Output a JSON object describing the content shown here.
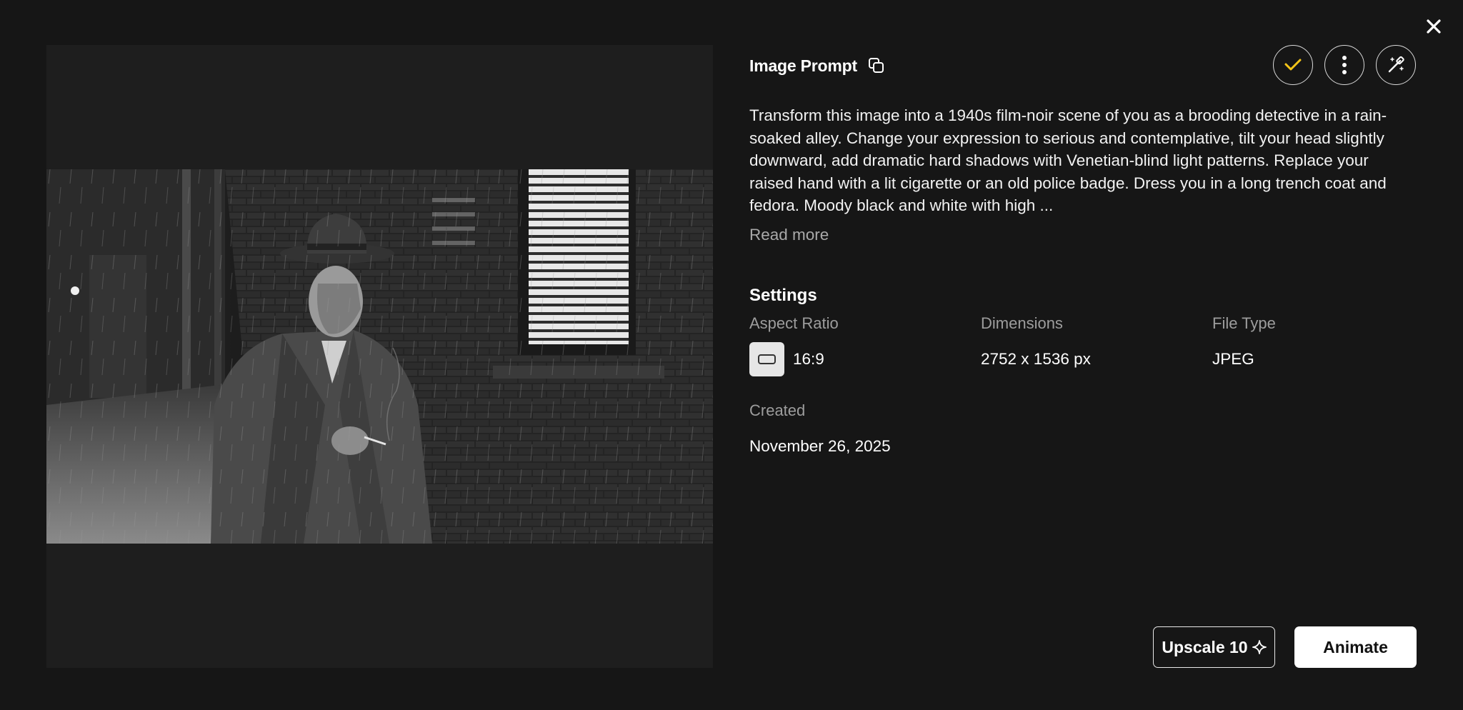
{
  "header": {
    "close_label": "close"
  },
  "prompt": {
    "title": "Image Prompt",
    "text": "Transform this image into a 1940s film-noir scene of you as a brooding detective in a rain-soaked alley. Change your expression to serious and contemplative, tilt your head slightly downward, add dramatic hard shadows with Venetian-blind light patterns. Replace your raised hand with a lit cigarette or an old police badge. Dress you in a long trench coat and fedora. Moody black and white with high ...",
    "read_more": "Read more"
  },
  "actions": {
    "icons": [
      "check-icon",
      "more-vertical-icon",
      "magic-wand-icon"
    ],
    "check_color": "#f5c518"
  },
  "settings": {
    "title": "Settings",
    "aspect_ratio_label": "Aspect Ratio",
    "aspect_ratio_value": "16:9",
    "dimensions_label": "Dimensions",
    "dimensions_value": "2752 x 1536 px",
    "file_type_label": "File Type",
    "file_type_value": "JPEG",
    "created_label": "Created",
    "created_value": "November 26, 2025"
  },
  "buttons": {
    "upscale_label": "Upscale 10",
    "animate_label": "Animate"
  },
  "colors": {
    "background": "#161616",
    "preview_bg": "#1e1e1e",
    "accent": "#f5c518"
  }
}
